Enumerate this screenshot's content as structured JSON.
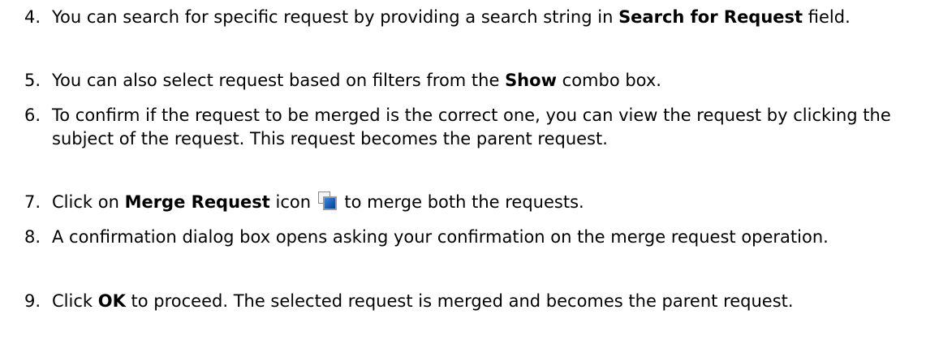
{
  "steps": [
    {
      "number": "4.",
      "text_before": "You can search for specific request by providing a search string in ",
      "bold": "Search for Request",
      "text_after": " field."
    },
    {
      "number": "5.",
      "text_before": "You can also select request based on filters from the ",
      "bold": "Show",
      "text_after": " combo box."
    },
    {
      "number": "6.",
      "text": "To confirm if the request to be merged is the correct one, you can view the request by clicking the subject of the request. This request becomes the parent request."
    },
    {
      "number": "7.",
      "text_before": "Click on ",
      "bold": "Merge Request",
      "text_middle": " icon ",
      "icon": "merge-request-icon",
      "text_after": " to merge both the requests."
    },
    {
      "number": "8.",
      "text": "A confirmation dialog box opens asking your confirmation on the merge request operation."
    },
    {
      "number": "9.",
      "text_before": "Click ",
      "bold": "OK",
      "text_after": " to proceed. The selected request is merged and becomes the parent request."
    }
  ]
}
